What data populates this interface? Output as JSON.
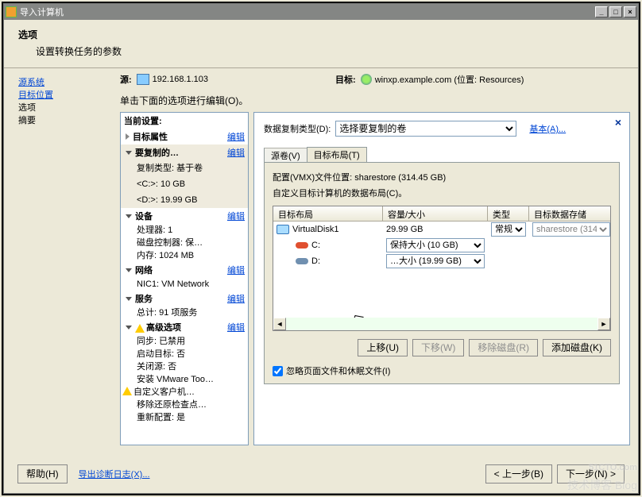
{
  "window": {
    "title": "导入计算机"
  },
  "header": {
    "title": "选项",
    "subtitle": "设置转换任务的参数"
  },
  "nav": {
    "items": [
      {
        "label": "源系统",
        "link": true
      },
      {
        "label": "目标位置",
        "link": true
      },
      {
        "label": "选项",
        "link": false
      },
      {
        "label": "摘要",
        "link": false
      }
    ]
  },
  "source": {
    "label": "源:",
    "ip": "192.168.1.103",
    "dest_label": "目标:",
    "dest_value": "winxp.example.com (位置: Resources)"
  },
  "instruction": "单击下面的选项进行编辑(O)。",
  "settings": {
    "current_label": "当前设置:",
    "edit": "编辑",
    "groups": {
      "target_props": "目标属性",
      "to_copy": "要复制的…",
      "copy_type": "复制类型: 基于卷",
      "c_drive": "<C:>: 10 GB",
      "d_drive": "<D:>: 19.99 GB",
      "devices": "设备",
      "cpu": "处理器: 1",
      "disk_ctrl": "磁盘控制器: 保…",
      "memory": "内存: 1024 MB",
      "network": "网络",
      "nic": "NIC1: VM Network",
      "services": "服务",
      "svc_total": "总计: 91 项服务",
      "advanced": "高级选项",
      "sync": "同步: 已禁用",
      "boot_target": "启动目标: 否",
      "shutdown_src": "关闭源: 否",
      "install_tools": "安装 VMware Too…",
      "customize": "自定义客户机…",
      "restore_chk": "移除还原检查点…",
      "reconfig": "重新配置:  是"
    }
  },
  "panel": {
    "copy_type_label": "数据复制类型(D):",
    "copy_type_value": "选择要复制的卷",
    "advanced_link": "基本(A)...",
    "tabs": {
      "src": "源卷(V)",
      "layout": "目标布局(T)"
    },
    "vmx_line": "配置(VMX)文件位置: sharestore (314.45 GB)",
    "custom_line": "自定义目标计算机的数据布局(C)。",
    "columns": {
      "c1": "目标布局",
      "c2": "容量/大小",
      "c3": "类型",
      "c4": "目标数据存储"
    },
    "rows": {
      "vdisk": {
        "name": "VirtualDisk1",
        "size": "29.99 GB",
        "type": "常规",
        "store": "sharestore (314."
      },
      "c": {
        "name": "C:",
        "size": "保持大小 (10 GB)"
      },
      "d": {
        "name": "D:",
        "size": "…大小 (19.99 GB)"
      }
    },
    "buttons": {
      "up": "上移(U)",
      "down": "下移(W)",
      "remove": "移除磁盘(R)",
      "add": "添加磁盘(K)"
    },
    "checkbox": "忽略页面文件和休眠文件(I)"
  },
  "footer": {
    "help": "帮助(H)",
    "export": "导出诊断日志(X)...",
    "back": "< 上一步(B)",
    "next": "下一步(N) >"
  },
  "watermark": {
    "big": "51CTO.com",
    "small": "技术博客  Blog"
  }
}
